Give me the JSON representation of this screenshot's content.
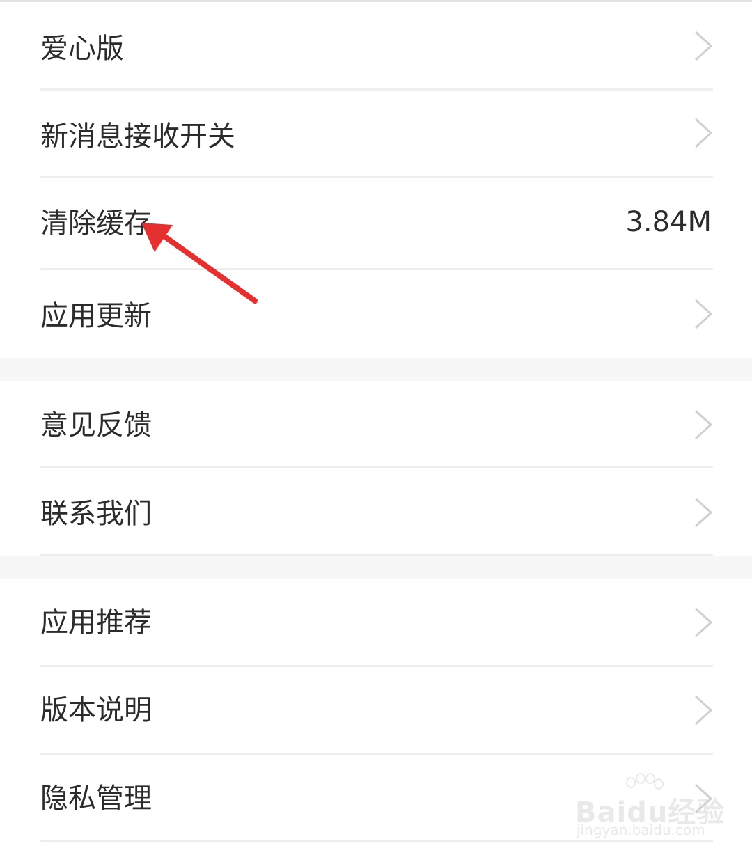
{
  "settings": {
    "group1": [
      {
        "label": "爱心版",
        "chevron": true
      },
      {
        "label": "新消息接收开关",
        "chevron": true
      },
      {
        "label": "清除缓存",
        "value": "3.84M"
      },
      {
        "label": "应用更新",
        "chevron": true
      }
    ],
    "group2": [
      {
        "label": "意见反馈",
        "chevron": true
      },
      {
        "label": "联系我们",
        "chevron": true
      }
    ],
    "group3": [
      {
        "label": "应用推荐",
        "chevron": true
      },
      {
        "label": "版本说明",
        "chevron": true
      },
      {
        "label": "隐私管理",
        "chevron": true
      }
    ]
  },
  "annotation": {
    "color": "#e53030",
    "points_to": "clear-cache"
  },
  "watermark": {
    "brand": "Baidu经验",
    "url": "jingyan.baidu.com"
  },
  "colors": {
    "background": "#f7f7f7",
    "row": "#ffffff",
    "text": "#2b2b2b",
    "chevron": "#cfcfcf",
    "divider": "#eeeeee"
  }
}
